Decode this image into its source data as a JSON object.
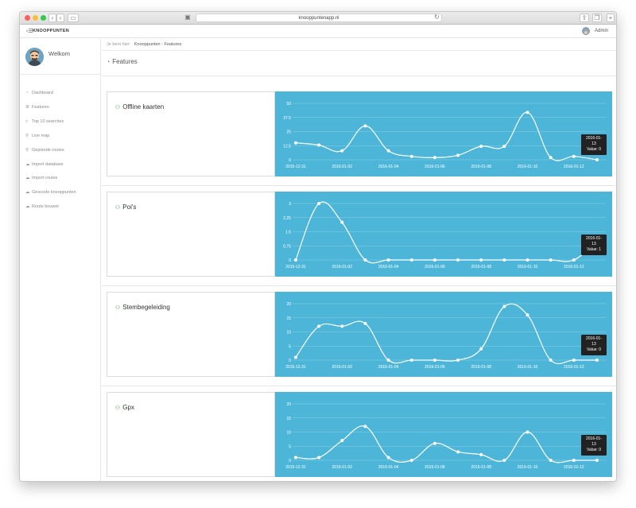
{
  "browser": {
    "url": "knooppuntenapp.nl"
  },
  "header": {
    "brand": "KNOOPPUNTEN",
    "user": "Admin"
  },
  "sidebar": {
    "welcome": "Welkom",
    "items": [
      {
        "label": "Dashboard",
        "icon": "dashboard-icon",
        "glyph": "◔"
      },
      {
        "label": "Features",
        "icon": "settings-icon",
        "glyph": "⚙"
      },
      {
        "label": "Top 10 searches",
        "icon": "search-icon",
        "glyph": "⌕"
      },
      {
        "label": "Live map",
        "icon": "map-marker-icon",
        "glyph": "⚲"
      },
      {
        "label": "Geplande routes",
        "icon": "map-marker-icon",
        "glyph": "⚲"
      },
      {
        "label": "Import database",
        "icon": "cloud-upload-icon",
        "glyph": "☁"
      },
      {
        "label": "Import routes",
        "icon": "cloud-upload-icon",
        "glyph": "☁"
      },
      {
        "label": "Geocode knooppunten",
        "icon": "cloud-upload-icon",
        "glyph": "☁"
      },
      {
        "label": "Route bouwer",
        "icon": "cloud-upload-icon",
        "glyph": "☁"
      }
    ]
  },
  "breadcrumb": {
    "prefix": "Je bent hier:",
    "items": [
      "Knooppunten",
      "Features"
    ],
    "separator": "›"
  },
  "page": {
    "title": "Features"
  },
  "chart_data": [
    {
      "type": "line",
      "title": "Offline kaarten",
      "x": [
        "2015-12-31",
        "2016-01-01",
        "2016-01-02",
        "2016-01-03",
        "2016-01-04",
        "2016-01-05",
        "2016-01-06",
        "2016-01-07",
        "2016-01-08",
        "2016-01-09",
        "2016-01-10",
        "2016-01-11",
        "2016-01-12",
        "2016-01-13"
      ],
      "x_tick_labels": [
        "2015-12-31",
        "2016-01-02",
        "2016-01-04",
        "2016-01-06",
        "2016-01-08",
        "2016-01-10",
        "2016-01-12"
      ],
      "values": [
        15,
        13,
        8,
        30,
        8,
        3,
        2,
        4,
        12,
        12,
        42,
        2,
        3,
        0
      ],
      "y_ticks": [
        "0",
        "12.5",
        "25",
        "37.5",
        "50"
      ],
      "ylim": [
        0,
        50
      ],
      "tooltip": {
        "label": "2016-01-13",
        "value_label": "Value: 0"
      }
    },
    {
      "type": "line",
      "title": "Poi's",
      "x": [
        "2015-12-31",
        "2016-01-01",
        "2016-01-02",
        "2016-01-03",
        "2016-01-04",
        "2016-01-05",
        "2016-01-06",
        "2016-01-07",
        "2016-01-08",
        "2016-01-09",
        "2016-01-10",
        "2016-01-11",
        "2016-01-12",
        "2016-01-13"
      ],
      "x_tick_labels": [
        "2015-12-31",
        "2016-01-02",
        "2016-01-04",
        "2016-01-06",
        "2016-01-08",
        "2016-01-10",
        "2016-01-12"
      ],
      "values": [
        0,
        3,
        2,
        0,
        0,
        0,
        0,
        0,
        0,
        0,
        0,
        0,
        0,
        1
      ],
      "y_ticks": [
        "0",
        "0.75",
        "1.5",
        "2.25",
        "3"
      ],
      "ylim": [
        0,
        3
      ],
      "tooltip": {
        "label": "2016-01-13",
        "value_label": "Value: 1"
      }
    },
    {
      "type": "line",
      "title": "Stembegeleiding",
      "x": [
        "2015-12-31",
        "2016-01-01",
        "2016-01-02",
        "2016-01-03",
        "2016-01-04",
        "2016-01-05",
        "2016-01-06",
        "2016-01-07",
        "2016-01-08",
        "2016-01-09",
        "2016-01-10",
        "2016-01-11",
        "2016-01-12",
        "2016-01-13"
      ],
      "x_tick_labels": [
        "2015-12-31",
        "2016-01-02",
        "2016-01-04",
        "2016-01-06",
        "2016-01-08",
        "2016-01-10",
        "2016-01-12"
      ],
      "values": [
        1,
        12,
        12,
        13,
        0,
        0,
        0,
        0,
        4,
        19,
        16,
        0,
        0,
        0
      ],
      "y_ticks": [
        "0",
        "5",
        "10",
        "15",
        "20"
      ],
      "ylim": [
        0,
        20
      ],
      "tooltip": {
        "label": "2016-01-13",
        "value_label": "Value: 0"
      }
    },
    {
      "type": "line",
      "title": "Gpx",
      "x": [
        "2015-12-31",
        "2016-01-01",
        "2016-01-02",
        "2016-01-03",
        "2016-01-04",
        "2016-01-05",
        "2016-01-06",
        "2016-01-07",
        "2016-01-08",
        "2016-01-09",
        "2016-01-10",
        "2016-01-11",
        "2016-01-12",
        "2016-01-13"
      ],
      "x_tick_labels": [
        "2015-12-31",
        "2016-01-02",
        "2016-01-04",
        "2016-01-06",
        "2016-01-08",
        "2016-01-10",
        "2016-01-12"
      ],
      "values": [
        1,
        1,
        7,
        12,
        1,
        0,
        6,
        3,
        2,
        0,
        10,
        0,
        0,
        0
      ],
      "y_ticks": [
        "0",
        "5",
        "10",
        "15",
        "20"
      ],
      "ylim": [
        0,
        20
      ],
      "tooltip": {
        "label": "2016-01-13",
        "value_label": "Value: 0"
      }
    }
  ],
  "colors": {
    "chart_bg": "#4db6d8",
    "line": "#ffffff",
    "feature_icon": "#3aa64a"
  }
}
